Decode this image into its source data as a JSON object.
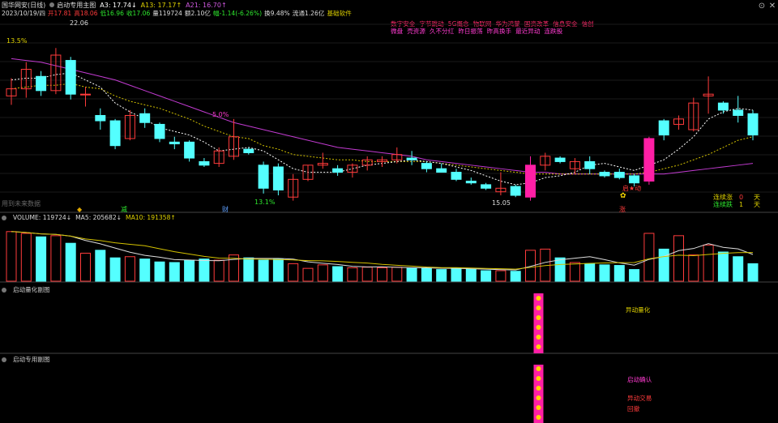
{
  "header": {
    "stock_name": "国华网安(日线)",
    "main_indicator": "启动专用主图",
    "a3": "A3: 17.74↓",
    "a13": "A13: 17.17↑",
    "a21": "A21: 16.70↑",
    "date_line": [
      "2023/10/19/四",
      "开17.81",
      "高18.06",
      "低16.96",
      "收17.06",
      "量119724",
      "额2.10亿",
      "幅-1.14(-6.26%)",
      "换9.48%",
      "流通1.26亿",
      "基础软件"
    ]
  },
  "tags": {
    "row1": [
      "数字安全",
      "字节跳动",
      "5G概念",
      "物联网",
      "华为鸿蒙",
      "国资改革",
      "信息安全",
      "信创"
    ],
    "row2": [
      "微盘",
      "壳资源",
      "久不分红",
      "昨日振荡",
      "昨高换手",
      "最近异动",
      "连跌股"
    ]
  },
  "annotations": {
    "pct_top": "13.5%",
    "high_label": "22.06",
    "low_label": "15.05",
    "mid_pct": "5.0%",
    "bottom_pct": "13.1%",
    "watermark": "用到未来数据",
    "marker_jian": "减",
    "marker_cai": "财",
    "marker_zhang": "涨",
    "signal_qidong": "启★动",
    "stat1_label": "连续涨",
    "stat1_value": "0",
    "stat1_unit": "天",
    "stat2_label": "连续跌",
    "stat2_value": "1",
    "stat2_unit": "天"
  },
  "volume_panel": {
    "label": "VOLUME: 119724↓",
    "ma5": "MA5: 205682↓",
    "ma10": "MA10: 191358↑"
  },
  "sub1": {
    "title": "启动量化副图",
    "signal_label": "异动量化"
  },
  "sub2": {
    "title": "启动专用副图",
    "label1": "启动确认",
    "label2": "异动交易",
    "label3": "回撤"
  },
  "colors": {
    "up": "#ff3b3b",
    "down": "#54ffff",
    "ma5": "#ffffff",
    "ma10": "#d4c200",
    "ma21": "#c23bd1",
    "signal": "#ff1fa5"
  },
  "chart_data": {
    "type": "candlestick",
    "ohlc": [
      [
        17.9,
        18.9,
        17.4,
        18.3
      ],
      [
        18.3,
        19.8,
        17.8,
        19.4
      ],
      [
        19.0,
        19.3,
        17.9,
        18.2
      ],
      [
        18.2,
        20.6,
        18.0,
        20.2
      ],
      [
        19.9,
        20.1,
        17.7,
        18.0
      ],
      [
        18.0,
        18.4,
        17.3,
        18.0
      ],
      [
        16.8,
        17.2,
        16.0,
        16.5
      ],
      [
        16.5,
        16.6,
        14.9,
        15.1
      ],
      [
        15.5,
        17.1,
        15.4,
        16.8
      ],
      [
        16.9,
        17.2,
        16.1,
        16.4
      ],
      [
        16.3,
        16.4,
        15.3,
        15.5
      ],
      [
        15.3,
        15.6,
        14.9,
        15.2
      ],
      [
        15.3,
        15.4,
        14.2,
        14.4
      ],
      [
        14.2,
        14.4,
        13.9,
        14.0
      ],
      [
        14.1,
        15.0,
        13.9,
        14.8
      ],
      [
        14.5,
        16.6,
        14.3,
        15.6
      ],
      [
        14.9,
        15.0,
        14.6,
        14.7
      ],
      [
        14.0,
        14.2,
        12.4,
        12.7
      ],
      [
        13.9,
        14.1,
        12.3,
        12.6
      ],
      [
        12.2,
        13.5,
        12.0,
        13.2
      ],
      [
        13.2,
        14.0,
        13.1,
        14.0
      ],
      [
        14.0,
        14.7,
        13.8,
        14.1
      ],
      [
        13.8,
        14.0,
        13.4,
        13.6
      ],
      [
        13.6,
        14.1,
        13.3,
        14.0
      ],
      [
        14.0,
        14.5,
        13.7,
        14.3
      ],
      [
        14.2,
        14.5,
        13.9,
        14.3
      ],
      [
        14.3,
        15.0,
        14.1,
        14.6
      ],
      [
        14.4,
        14.8,
        14.0,
        14.3
      ],
      [
        14.1,
        14.2,
        13.6,
        13.8
      ],
      [
        13.8,
        14.1,
        13.6,
        13.6
      ],
      [
        13.6,
        13.8,
        13.1,
        13.2
      ],
      [
        13.1,
        13.3,
        12.9,
        13.0
      ],
      [
        12.9,
        13.0,
        12.6,
        12.7
      ],
      [
        12.5,
        13.6,
        12.3,
        12.7
      ],
      [
        12.8,
        12.9,
        12.2,
        12.3
      ],
      [
        12.2,
        14.5,
        12.0,
        14.0
      ],
      [
        14.0,
        14.7,
        13.7,
        14.5
      ],
      [
        14.4,
        14.5,
        14.1,
        14.2
      ],
      [
        13.8,
        14.4,
        13.5,
        14.2
      ],
      [
        14.2,
        14.5,
        13.5,
        13.8
      ],
      [
        13.6,
        13.7,
        13.3,
        13.4
      ],
      [
        13.6,
        13.8,
        13.2,
        13.3
      ],
      [
        13.4,
        13.5,
        12.8,
        13.0
      ],
      [
        13.1,
        15.6,
        12.9,
        15.5
      ],
      [
        16.5,
        16.6,
        15.4,
        15.7
      ],
      [
        16.3,
        16.8,
        16.0,
        16.6
      ],
      [
        16.0,
        17.8,
        15.9,
        17.5
      ],
      [
        17.9,
        19.0,
        16.9,
        18.0
      ],
      [
        17.5,
        17.6,
        16.9,
        17.1
      ],
      [
        17.1,
        17.9,
        16.4,
        16.8
      ],
      [
        16.9,
        17.1,
        15.4,
        15.7
      ]
    ],
    "volume_ratio": [
      0.85,
      0.82,
      0.76,
      0.78,
      0.65,
      0.48,
      0.53,
      0.4,
      0.42,
      0.38,
      0.33,
      0.32,
      0.36,
      0.38,
      0.36,
      0.45,
      0.4,
      0.36,
      0.38,
      0.3,
      0.22,
      0.28,
      0.25,
      0.23,
      0.24,
      0.23,
      0.24,
      0.22,
      0.22,
      0.2,
      0.22,
      0.21,
      0.18,
      0.18,
      0.17,
      0.53,
      0.55,
      0.4,
      0.32,
      0.3,
      0.28,
      0.27,
      0.2,
      0.82,
      0.55,
      0.78,
      0.45,
      0.62,
      0.5,
      0.42,
      0.3
    ],
    "ma5": [
      18.8,
      18.9,
      18.9,
      19.1,
      19.2,
      18.8,
      18.4,
      17.5,
      17.0,
      16.6,
      16.1,
      15.9,
      15.7,
      15.3,
      14.8,
      14.9,
      15.0,
      14.8,
      14.3,
      13.8,
      13.6,
      13.6,
      13.6,
      13.8,
      14.0,
      14.1,
      14.2,
      14.3,
      14.2,
      14.1,
      13.9,
      13.7,
      13.4,
      13.1,
      12.9,
      13.0,
      13.3,
      13.4,
      13.6,
      14.0,
      14.1,
      13.9,
      13.7,
      14.0,
      14.3,
      14.9,
      15.6,
      16.6,
      17.0,
      17.2,
      17.1
    ],
    "ma10": [
      18.3,
      18.4,
      18.5,
      18.5,
      18.6,
      18.4,
      18.3,
      17.9,
      17.6,
      17.4,
      17.2,
      16.9,
      16.6,
      16.2,
      15.9,
      15.6,
      15.5,
      15.1,
      14.9,
      14.6,
      14.5,
      14.4,
      14.3,
      14.3,
      14.2,
      14.2,
      14.2,
      14.2,
      14.2,
      14.1,
      14.0,
      13.9,
      13.8,
      13.7,
      13.6,
      13.5,
      13.5,
      13.5,
      13.5,
      13.5,
      13.5,
      13.5,
      13.5,
      13.6,
      13.8,
      14.0,
      14.3,
      14.6,
      15.0,
      15.4,
      15.6
    ],
    "ma21": [
      20.0,
      19.9,
      19.8,
      19.6,
      19.4,
      19.2,
      19.0,
      18.8,
      18.5,
      18.2,
      17.9,
      17.6,
      17.3,
      17.0,
      16.7,
      16.4,
      16.2,
      16.0,
      15.8,
      15.6,
      15.4,
      15.2,
      15.0,
      14.9,
      14.8,
      14.7,
      14.6,
      14.5,
      14.3,
      14.2,
      14.1,
      14.0,
      13.9,
      13.8,
      13.7,
      13.6,
      13.6,
      13.5,
      13.5,
      13.5,
      13.5,
      13.5,
      13.5,
      13.5,
      13.5,
      13.6,
      13.7,
      13.8,
      13.9,
      14.0,
      14.1
    ],
    "highlight_index": [
      35,
      43
    ],
    "grid": true
  }
}
